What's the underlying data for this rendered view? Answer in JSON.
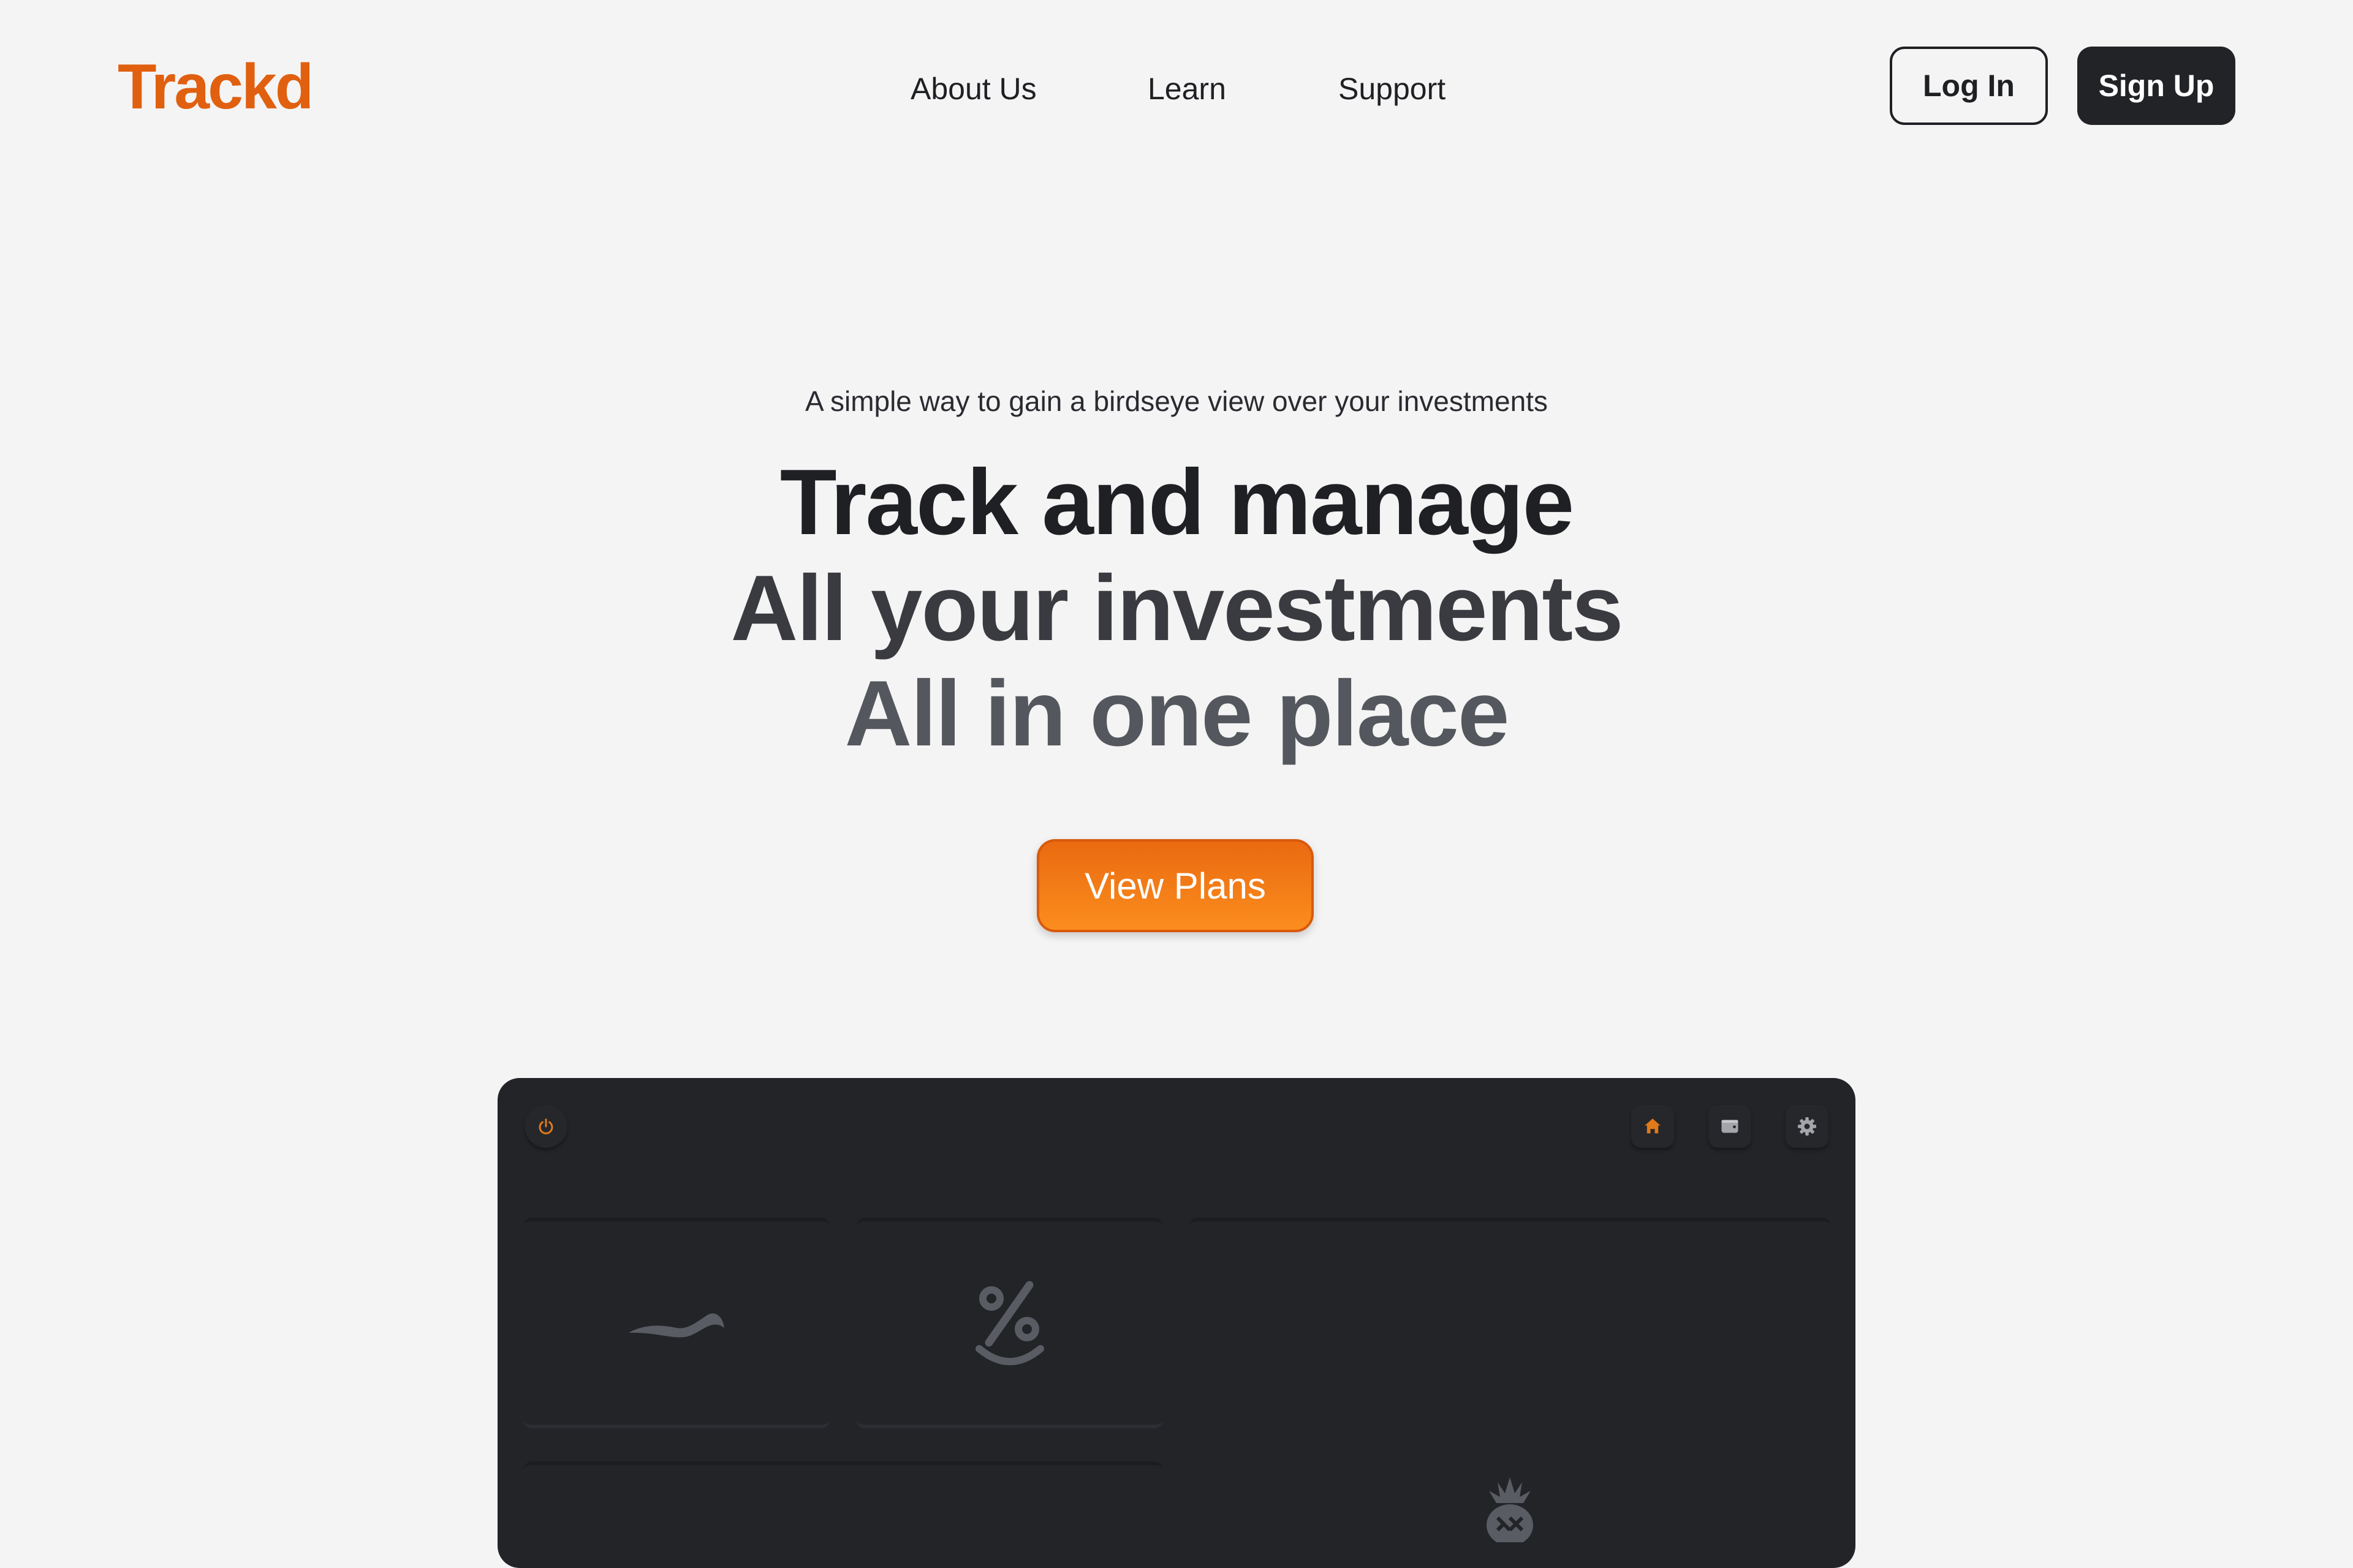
{
  "header": {
    "logo": "Trackd",
    "nav": [
      {
        "label": "About Us"
      },
      {
        "label": "Learn"
      },
      {
        "label": "Support"
      }
    ],
    "login_label": "Log In",
    "signup_label": "Sign Up"
  },
  "hero": {
    "tagline": "A simple way to gain a birdseye view over your investments",
    "line1": "Track and manage",
    "line2": "All your investments",
    "line3": "All in one place",
    "cta_label": "View Plans"
  },
  "preview": {
    "icons": {
      "power": "power-icon",
      "home": "home-icon",
      "wallet": "wallet-icon",
      "settings": "gear-icon"
    },
    "cards": [
      {
        "icon": "wave-icon"
      },
      {
        "icon": "percent-smile-icon"
      },
      {
        "icon": "pineapple-icon"
      },
      {
        "icon": ""
      }
    ]
  },
  "colors": {
    "background": "#f4f4f4",
    "brand": "#e06010",
    "accent_gradient_top": "#ea6a10",
    "accent_gradient_bottom": "#fb8d1e",
    "dark": "#222327",
    "preview_bg": "#232428",
    "muted_icon": "#5a5c63"
  }
}
